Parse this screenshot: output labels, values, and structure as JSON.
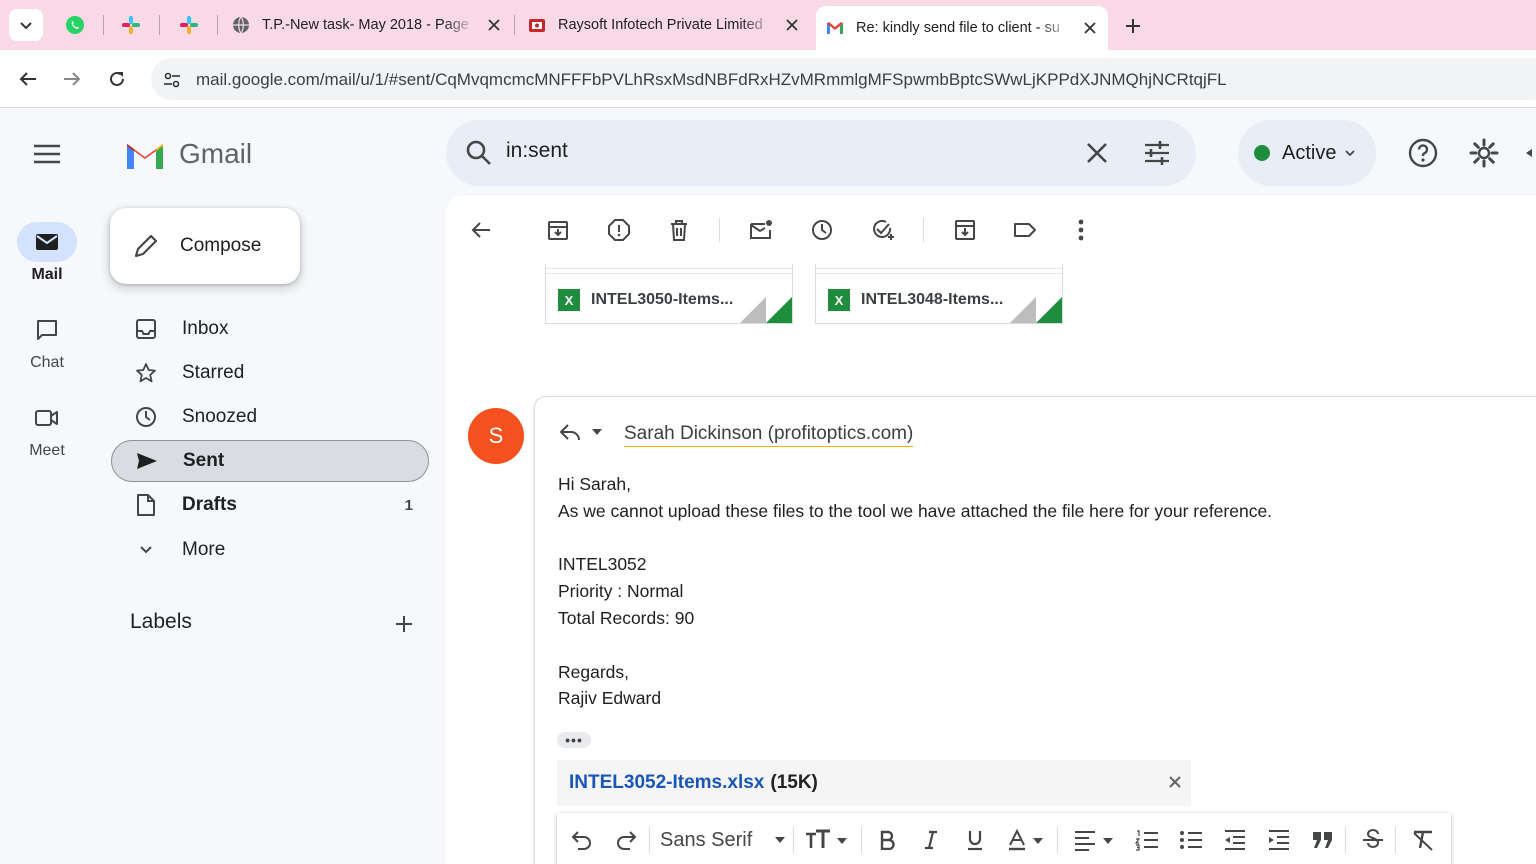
{
  "browser": {
    "tabs": [
      {
        "title": "T.P.-New task- May 2018 - Page",
        "favicon": "globe-icon"
      },
      {
        "title": "Raysoft Infotech Private Limited",
        "favicon": "raysoft-logo"
      },
      {
        "title": "Re: kindly send file to client - su",
        "favicon": "gmail-icon",
        "active": true
      }
    ],
    "url": "mail.google.com/mail/u/1/#sent/CqMvqmcmcMNFFFbPVLhRsxMsdNBFdRxHZvMRmmlgMFSpwmbBptcSWwLjKPPdXJNMQhjNCRtqjFL"
  },
  "rail": {
    "items": [
      {
        "label": "Mail",
        "icon": "mail-icon",
        "active": true
      },
      {
        "label": "Chat",
        "icon": "chat-icon"
      },
      {
        "label": "Meet",
        "icon": "video-icon"
      }
    ]
  },
  "nav": {
    "brand": "Gmail",
    "compose": "Compose",
    "items": [
      {
        "label": "Inbox",
        "icon": "inbox-icon",
        "count": ""
      },
      {
        "label": "Starred",
        "icon": "star-icon",
        "count": ""
      },
      {
        "label": "Snoozed",
        "icon": "clock-icon",
        "count": ""
      },
      {
        "label": "Sent",
        "icon": "send-icon",
        "count": "",
        "active": true
      },
      {
        "label": "Drafts",
        "icon": "draft-icon",
        "count": "1"
      },
      {
        "label": "More",
        "icon": "chevron-down-icon",
        "count": ""
      }
    ],
    "labels_heading": "Labels"
  },
  "header": {
    "search_query": "in:sent",
    "status": "Active"
  },
  "message": {
    "attachments_above": [
      "INTEL3050-Items...",
      "INTEL3048-Items..."
    ],
    "avatar_letter": "S",
    "recipient": "Sarah Dickinson (profitoptics.com)",
    "body_lines": [
      "Hi Sarah,",
      "As we cannot upload these files to the tool we have attached the file here for your reference.",
      "",
      "INTEL3052",
      "Priority : Normal",
      "Total Records: 90",
      "",
      "Regards,",
      "Rajiv Edward"
    ],
    "trimmed": "•••",
    "attachment_name": "INTEL3052-Items.xlsx",
    "attachment_size": "(15K)",
    "font": "Sans Serif"
  },
  "colors": {
    "tabstrip": "#f9d9e5",
    "avatar": "#f4511e",
    "link": "#1a56b8",
    "excel": "#1e8e3e"
  }
}
